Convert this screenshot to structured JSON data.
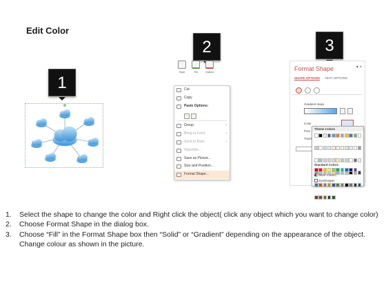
{
  "title": "Edit Color",
  "steps": [
    {
      "badge": "1"
    },
    {
      "badge": "2"
    },
    {
      "badge": "3"
    }
  ],
  "context_toolbar": {
    "buttons": [
      "Style",
      "Fill",
      "Outline"
    ]
  },
  "context_menu": {
    "items": [
      {
        "label": "Cut",
        "icon": "scissors-icon",
        "state": "normal"
      },
      {
        "label": "Copy",
        "icon": "copy-icon",
        "state": "normal"
      },
      {
        "label": "Paste Options:",
        "icon": "clipboard-icon",
        "state": "bold"
      },
      {
        "label": "Group",
        "icon": "group-icon",
        "state": "normal",
        "submenu": true
      },
      {
        "label": "Bring to Front",
        "icon": "bring-front-icon",
        "state": "dim",
        "submenu": true
      },
      {
        "label": "Send to Back",
        "icon": "send-back-icon",
        "state": "dim",
        "submenu": true
      },
      {
        "label": "Hyperlink...",
        "icon": "link-icon",
        "state": "dim"
      },
      {
        "label": "Save as Picture...",
        "icon": "picture-icon",
        "state": "normal"
      },
      {
        "label": "Size and Position...",
        "icon": "size-icon",
        "state": "normal"
      },
      {
        "label": "Format Shape...",
        "icon": "format-shape-icon",
        "state": "highlight"
      }
    ]
  },
  "format_pane": {
    "title": "Format Shape",
    "controls": "▾ ×",
    "tabs": [
      "SHAPE OPTIONS",
      "TEXT OPTIONS"
    ],
    "gradient_stops_label": "Gradient stops",
    "color_label": "Color",
    "position_label": "Posi",
    "transparency_label": "Trans",
    "accent_color": "#c0504d"
  },
  "color_picker": {
    "theme_label": "Theme Colors",
    "standard_label": "Standard Colors",
    "more_colors": "More Colors...",
    "eyedropper": "Eyedropper",
    "theme_columns": [
      "#ffffff",
      "#000000",
      "#e7e6e6",
      "#44546a",
      "#5b9bd5",
      "#ed7d31",
      "#a5a5a5",
      "#ffc000",
      "#4472c4",
      "#70ad47"
    ],
    "standard_colors": [
      "#c00000",
      "#ff0000",
      "#ffc000",
      "#ffff00",
      "#92d050",
      "#00b050",
      "#00b0f0",
      "#0070c0",
      "#002060",
      "#7030a0"
    ]
  },
  "instructions": [
    {
      "num": "1.",
      "text": "Select the shape to change the color and Right click the object( click any object which you want to change color)"
    },
    {
      "num": "2.",
      "text": "Choose Format Shape in the dialog box."
    },
    {
      "num": "3.",
      "text": "Choose “Fill” in the Format Shape box then “Solid” or “Gradient” depending on the appearance of the object. Change colour as shown in the picture."
    }
  ]
}
